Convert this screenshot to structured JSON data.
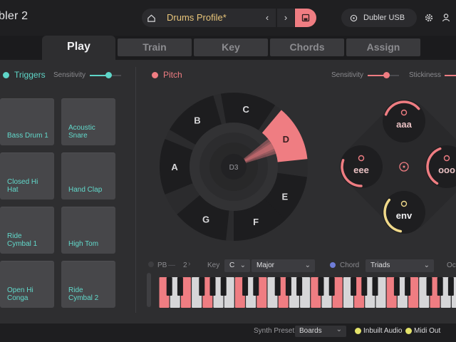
{
  "app": {
    "title": "bler 2"
  },
  "header": {
    "profile_name": "Drums Profile*",
    "prev_label": "‹",
    "next_label": "›",
    "device_name": "Dubler USB",
    "icons": {
      "home": "home-icon",
      "save": "save-icon",
      "device": "power-icon",
      "settings": "gear-icon",
      "account": "user-icon"
    }
  },
  "tabs": [
    {
      "label": "Play",
      "active": true
    },
    {
      "label": "Train"
    },
    {
      "label": "Key"
    },
    {
      "label": "Chords"
    },
    {
      "label": "Assign"
    }
  ],
  "triggers": {
    "title": "Triggers",
    "sensitivity_label": "Sensitivity",
    "sensitivity_level": 0.6,
    "accent": "#5fd6c8",
    "pads": [
      "Bass Drum 1",
      "Acoustic Snare",
      "Closed Hi Hat",
      "Hand Clap",
      "Ride Cymbal 1",
      "High Tom",
      "Open Hi Conga",
      "Ride Cymbal 2"
    ]
  },
  "pitch": {
    "title": "Pitch",
    "sensitivity_label": "Sensitivity",
    "sensitivity_level": 0.6,
    "stickiness_label": "Stickiness",
    "accent": "#ef7d82",
    "current_note": "D3",
    "active_note": "D",
    "notes": [
      "C",
      "D",
      "E",
      "F",
      "G",
      "A",
      "B"
    ]
  },
  "vowels": {
    "labels": [
      "aaa",
      "eee",
      "ooo",
      "env"
    ],
    "center_icon": "chat-icon"
  },
  "keyboard_controls": {
    "pb_label": "PB",
    "pb_dash": "—",
    "pb_value": "2",
    "key_label": "Key",
    "key_value": "C",
    "scale_value": "Major",
    "chord_label": "Chord",
    "chord_value": "Triads",
    "octave_label": "Oc"
  },
  "bottom": {
    "synth_label": "Synth Preset",
    "synth_value": "Boards",
    "inbuilt_audio": "Inbuilt Audio",
    "midi_out": "Midi Out"
  }
}
